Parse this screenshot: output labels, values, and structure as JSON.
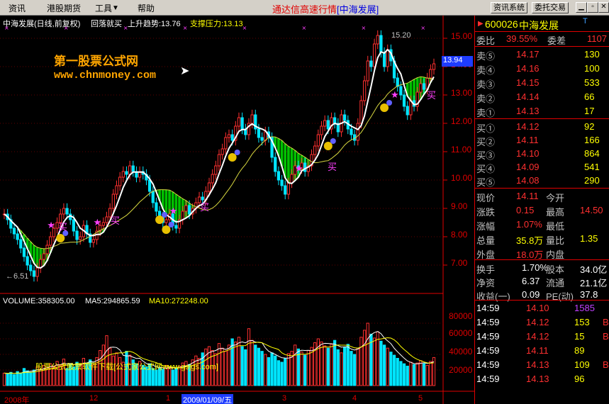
{
  "menu": {
    "items": [
      "资讯",
      "港股期货",
      "工具",
      "帮助"
    ],
    "title_main": "通达信高速行情",
    "title_sub": "[中海发展]",
    "btn_news": "资讯系统",
    "btn_trade": "委托交易"
  },
  "chart_header": {
    "stock": "中海发展(日线,前复权)",
    "indicator": "回落就买",
    "trend": "上升趋势:13.76",
    "support": "支撑压力:13.13"
  },
  "watermark": {
    "line1": "第一股票公式网",
    "line2": "www.chnmoney.com",
    "footer": "股票公式股票软件下载[公式家公式网www.gsjgs.com]"
  },
  "chart_labels": {
    "high": "15.20",
    "low": "6.51",
    "current": "13.94",
    "buy": "买"
  },
  "volume_header": {
    "volume": "VOLUME:358305.00",
    "ma5": "MA5:294865.59",
    "ma10": "MA10:272248.00"
  },
  "x_labels": [
    "2008年",
    "12",
    "1",
    "2009/01/09/五",
    "3",
    "4",
    "5"
  ],
  "chart_data": {
    "type": "candlestick",
    "price_axis": {
      "ticks": [
        "15.00",
        "14.00",
        "13.00",
        "12.00",
        "11.00",
        "10.00",
        "9.00",
        "8.00",
        "7.00"
      ],
      "ylim": [
        6.3,
        15.6
      ]
    },
    "volume_axis": {
      "ticks": [
        "80000",
        "60000",
        "40000",
        "20000"
      ],
      "ylim": [
        0,
        100000
      ]
    },
    "close": [
      8.8,
      8.6,
      8.3,
      8.1,
      7.9,
      7.6,
      7.3,
      7.0,
      6.8,
      6.6,
      6.9,
      7.2,
      7.4,
      7.7,
      8.0,
      8.3,
      8.5,
      8.8,
      9.0,
      8.8,
      8.6,
      8.2,
      7.9,
      8.0,
      8.4,
      8.1,
      7.8,
      7.9,
      8.2,
      8.4,
      8.5,
      8.7,
      9.0,
      9.5,
      9.8,
      10.1,
      10.3,
      10.2,
      10.5,
      10.3,
      10.1,
      10.3,
      10.2,
      10.0,
      9.6,
      9.2,
      8.9,
      8.7,
      8.5,
      8.6,
      8.8,
      8.4,
      8.3,
      8.6,
      8.9,
      9.1,
      8.8,
      9.0,
      9.2,
      9.4,
      9.3,
      9.6,
      9.9,
      10.2,
      10.5,
      10.9,
      11.1,
      11.5,
      11.6,
      11.4,
      11.9,
      12.2,
      11.8,
      11.6,
      12.0,
      12.3,
      11.8,
      11.5,
      11.4,
      11.7,
      11.5,
      10.8,
      10.3,
      10.0,
      9.8,
      9.5,
      9.9,
      10.2,
      10.5,
      10.4,
      10.6,
      10.3,
      10.5,
      10.9,
      11.2,
      11.6,
      11.9,
      12.1,
      11.8,
      12.2,
      12.0,
      11.7,
      12.3,
      12.1,
      11.8,
      11.6,
      11.4,
      12.0,
      12.8,
      13.5,
      14.2,
      14.0,
      14.8,
      15.1,
      14.5,
      14.0,
      14.6,
      14.2,
      13.6,
      13.3,
      13.0,
      12.6,
      12.3,
      12.8,
      12.6,
      13.1,
      13.4,
      13.2,
      13.6,
      13.9,
      14.1
    ],
    "volume": [
      16000,
      15000,
      17000,
      14000,
      18000,
      16000,
      22000,
      19000,
      17000,
      20000,
      24000,
      21000,
      26000,
      23000,
      28000,
      25000,
      31000,
      26000,
      34000,
      22000,
      28000,
      24000,
      30000,
      27000,
      35000,
      29000,
      33000,
      27000,
      36000,
      45000,
      52000,
      64000,
      48000,
      38000,
      42000,
      36000,
      30000,
      44000,
      39000,
      33000,
      28000,
      31000,
      26000,
      24000,
      28000,
      22000,
      20000,
      23000,
      21000,
      26000,
      24000,
      20000,
      22000,
      25000,
      29000,
      31000,
      27000,
      33000,
      38000,
      35000,
      42000,
      47000,
      50000,
      45000,
      41000,
      54000,
      48000,
      44000,
      52000,
      60000,
      56000,
      62000,
      50000,
      46000,
      73000,
      58000,
      52000,
      48000,
      44000,
      40000,
      36000,
      42000,
      38000,
      32000,
      30000,
      35000,
      41000,
      44000,
      52000,
      47000,
      43000,
      39000,
      45000,
      49000,
      55000,
      60000,
      56000,
      51000,
      48000,
      53000,
      58000,
      46000,
      42000,
      49000,
      53000,
      44000,
      40000,
      48000,
      62000,
      71000,
      80000,
      66000,
      61000,
      69000,
      57000,
      52000,
      48000,
      43000,
      39000,
      35000,
      31000,
      28000,
      25000,
      30000,
      27000,
      29000,
      32000,
      28000,
      26000,
      31000,
      36000
    ]
  },
  "panel": {
    "code": "600026",
    "name": "中海发展",
    "tag": "T",
    "weibi_label": "委比",
    "weibi_value": "39.55%",
    "weicha_label": "委差",
    "weicha_value": "1107",
    "sells": [
      {
        "label": "卖⑤",
        "price": "14.17",
        "vol": "130"
      },
      {
        "label": "卖④",
        "price": "14.16",
        "vol": "100"
      },
      {
        "label": "卖③",
        "price": "14.15",
        "vol": "533"
      },
      {
        "label": "卖②",
        "price": "14.14",
        "vol": "66"
      },
      {
        "label": "卖①",
        "price": "14.13",
        "vol": "17"
      }
    ],
    "buys": [
      {
        "label": "买①",
        "price": "14.12",
        "vol": "92"
      },
      {
        "label": "买②",
        "price": "14.11",
        "vol": "166"
      },
      {
        "label": "买③",
        "price": "14.10",
        "vol": "864"
      },
      {
        "label": "买④",
        "price": "14.09",
        "vol": "541"
      },
      {
        "label": "买⑤",
        "price": "14.08",
        "vol": "290"
      }
    ],
    "stats": [
      {
        "l1": "现价",
        "v1": "14.11",
        "c1": "#ff3030",
        "l2": "今开",
        "v2": "",
        "c2": "#ff3030"
      },
      {
        "l1": "涨跌",
        "v1": "0.15",
        "c1": "#ff3030",
        "l2": "最高",
        "v2": "14.50",
        "c2": "#ff3030"
      },
      {
        "l1": "涨幅",
        "v1": "1.07%",
        "c1": "#ff3030",
        "l2": "最低",
        "v2": "",
        "c2": "#ff3030"
      },
      {
        "l1": "总量",
        "v1": "35.8万",
        "c1": "#ffff00",
        "l2": "量比",
        "v2": "1.35",
        "c2": "#ffff00"
      },
      {
        "l1": "外盘",
        "v1": "18.0万",
        "c1": "#ff3030",
        "l2": "内盘",
        "v2": "",
        "c2": "#00ff00"
      }
    ],
    "fin": [
      {
        "l1": "换手",
        "v1": "1.70%",
        "l2": "股本",
        "v2": "34.0亿"
      },
      {
        "l1": "净资",
        "v1": "6.37",
        "l2": "流通",
        "v2": "21.1亿"
      },
      {
        "l1": "收益(一)",
        "v1": "0.09",
        "l2": "PE(动)",
        "v2": "37.8"
      }
    ],
    "ticks": [
      {
        "time": "14:59",
        "price": "14.10",
        "vol": "1585",
        "dir": "",
        "vc": "#c040ff"
      },
      {
        "time": "14:59",
        "price": "14.12",
        "vol": "153",
        "dir": "B",
        "vc": "#ffff00"
      },
      {
        "time": "14:59",
        "price": "14.12",
        "vol": "15",
        "dir": "B",
        "vc": "#ffff00"
      },
      {
        "time": "14:59",
        "price": "14.11",
        "vol": "89",
        "dir": "",
        "vc": "#ffff00"
      },
      {
        "time": "14:59",
        "price": "14.13",
        "vol": "109",
        "dir": "B",
        "vc": "#ffff00"
      },
      {
        "time": "14:59",
        "price": "14.13",
        "vol": "96",
        "dir": "",
        "vc": "#ffff00"
      }
    ]
  }
}
